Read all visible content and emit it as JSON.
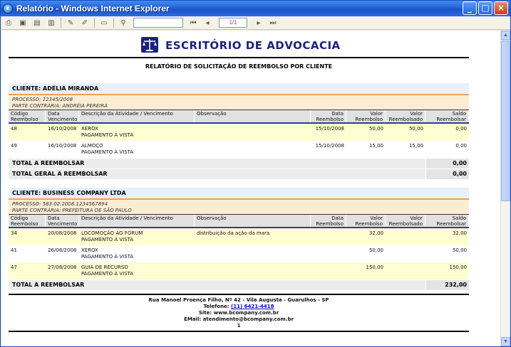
{
  "window": {
    "title": "Relatório - Windows Internet Explorer"
  },
  "toolbar": {
    "page_indicator": "1/1"
  },
  "report": {
    "company": "ESCRITÓRIO DE ADVOCACIA",
    "title": "RELATÓRIO DE SOLICITAÇÃO DE REEMBOLSO POR CLIENTE",
    "columns": {
      "codigo": "Código\nReembolso",
      "data_venc": "Data\nVencimento",
      "descricao": "Descrição da Atividade / Vencimento",
      "observacao": "Observação",
      "data_reemb": "Data\nReembolso",
      "valor_reemb": "Valor\nReembolso",
      "valor_reembolsado": "Valor\nReembolsado",
      "saldo": "Saldo\nReembolsar"
    },
    "clients": [
      {
        "name": "CLIENTE: ADÉLIA MIRANDA",
        "process": "PROCESSO: 12345/2008",
        "opposing": "PARTE CONTRÁRIA: ANDRÉIA PEREIRA",
        "rows": [
          {
            "codigo": "48",
            "data_venc": "16/10/2008",
            "desc": "XEROX",
            "desc2": "PAGAMENTO À VISTA",
            "obs": "",
            "data_reemb": "15/10/2008",
            "valor": "50,00",
            "reembolsado": "50,00",
            "saldo": "0,00"
          },
          {
            "codigo": "49",
            "data_venc": "16/10/2008",
            "desc": "ALMOÇO",
            "desc2": "PAGAMENTO À VISTA",
            "obs": "",
            "data_reemb": "15/10/2008",
            "valor": "15,00",
            "reembolsado": "15,00",
            "saldo": "0,00"
          }
        ],
        "total_label": "TOTAL A REEMBOLSAR",
        "total": "0,00",
        "grand_label": "TOTAL GERAL A REEMBOLSAR",
        "grand_total": "0,00"
      },
      {
        "name": "CLIENTE: BUSINESS COMPANY LTDA",
        "process": "PROCESSO: 583.02.2008.1234567894",
        "opposing": "PARTE CONTRÁRIA: PREFEITURA DE SÃO PAULO",
        "rows": [
          {
            "codigo": "34",
            "data_venc": "20/08/2008",
            "desc": "LOCOMOÇÃO AO FORUM",
            "desc2": "PAGAMENTO À VISTA",
            "obs": "distribuição da ação da mara",
            "data_reemb": "",
            "valor": "32,00",
            "reembolsado": "",
            "saldo": "32,00"
          },
          {
            "codigo": "41",
            "data_venc": "26/08/2008",
            "desc": "XEROX",
            "desc2": "PAGAMENTO À VISTA",
            "obs": "",
            "data_reemb": "",
            "valor": "50,00",
            "reembolsado": "",
            "saldo": "50,00"
          },
          {
            "codigo": "47",
            "data_venc": "27/08/2008",
            "desc": "GUIA DE RECURSO",
            "desc2": "PAGAMENTO À VISTA",
            "obs": "",
            "data_reemb": "",
            "valor": "150,00",
            "reembolsado": "",
            "saldo": "150,00"
          }
        ],
        "total_label": "TOTAL A REEMBOLSAR",
        "total": "232,00"
      }
    ],
    "footer": {
      "address": "Rua Manoel Proença Filho, Nº 42 - Vila Augusta - Guarulhos - SP",
      "phone_label": "Telefone: ",
      "phone": "(11) 6421-4418",
      "site": "Site: www.bcompany.com.br",
      "email": "EMail: atendimento@bcompany.com.br",
      "page": "1"
    }
  }
}
